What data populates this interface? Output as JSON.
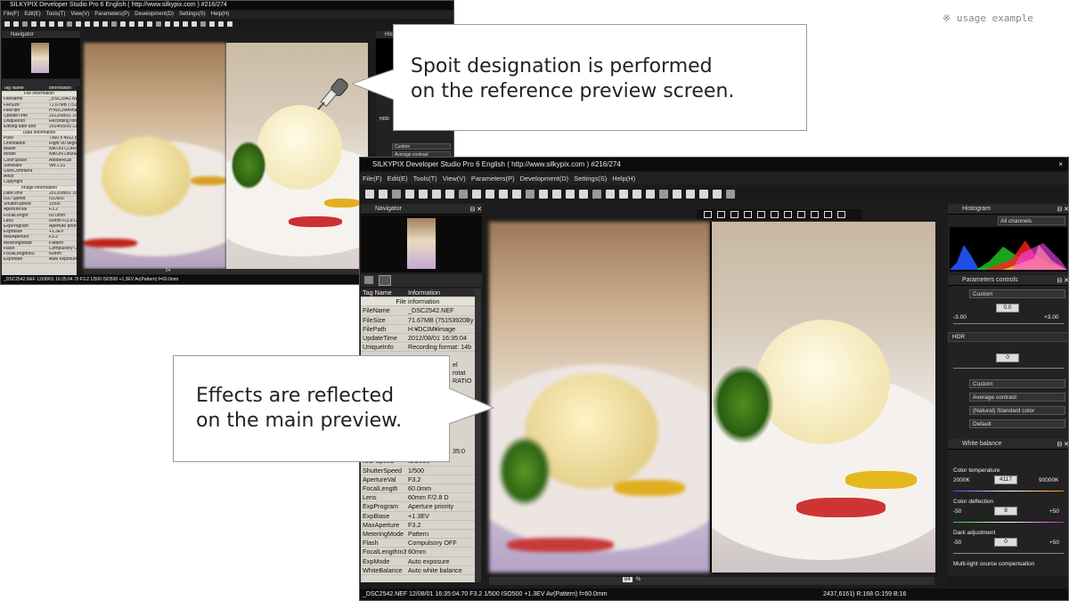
{
  "usage_note": "※ usage example",
  "back_window": {
    "title": "SILKYPIX Developer Studio Pro 6 English ( http://www.silkypix.com )  #216/274",
    "menu": [
      "File(F)",
      "Edit(E)",
      "Tools(T)",
      "View(V)",
      "Parameters(P)",
      "Development(D)",
      "Settings(S)",
      "Help(H)"
    ],
    "navigator_label": "Navigator",
    "histogram_label": "Histo",
    "tag_header": [
      "Tag Name",
      "Information"
    ],
    "file_section": "File information",
    "data_section": "Data information",
    "image_section": "Image information",
    "file_rows": [
      [
        "FileName",
        "_DSC2542.NEF"
      ],
      [
        "FileSize",
        "71.67MB (75153920By"
      ],
      [
        "FilePath",
        "H:¥DCIM¥image"
      ],
      [
        "UpdateTime",
        "2012/08/01 16:35:04"
      ],
      [
        "UniqueInfo",
        "Recording format: 14b"
      ],
      [
        "Editing date and",
        "2014/05/05 11:00:56"
      ]
    ],
    "data_rows": [
      [
        "Pixel",
        "7360 x 4912 pixel"
      ],
      [
        "Orientation",
        "Right 90 degree rotate"
      ],
      [
        "Maker",
        "NIKON CORPORATION"
      ],
      [
        "Model",
        "NIKON D800E"
      ],
      [
        "ColorSpace",
        "AdobeRGB"
      ],
      [
        "SoftWare",
        "Ver.1.01"
      ],
      [
        "UserComment",
        ""
      ],
      [
        "Artist",
        ""
      ],
      [
        "Copyright",
        ""
      ]
    ],
    "image_rows": [
      [
        "DateTime",
        "2012/08/01 16:35:0"
      ],
      [
        "ISO Speed",
        "ISO500"
      ],
      [
        "ShutterSpeed",
        "1/500"
      ],
      [
        "ApertureVal",
        "F3.2"
      ],
      [
        "FocalLength",
        "60.0mm"
      ],
      [
        "Lens",
        "60mm F/2.8 D"
      ],
      [
        "ExpProgram",
        "Aperture priority"
      ],
      [
        "ExpBiase",
        "+1.3EV"
      ],
      [
        "MaxAperture",
        "F3.2"
      ],
      [
        "MeteringMode",
        "Pattern"
      ],
      [
        "Flash",
        "Compulsory OFF"
      ],
      [
        "FocalLengthIn3",
        "60mm"
      ],
      [
        "ExpMode",
        "Auto exposure"
      ]
    ],
    "hdr_label": "HDR",
    "custom_label": "Custom",
    "avg_label": "Average contrast",
    "zoom": "84",
    "status": "_DSC2542.NEF 12/08/01 16:35:04.70 F3.2 1/500 ISO500 +1.3EV Av(Pattern) f=60.0mm"
  },
  "front_window": {
    "title": "SILKYPIX Developer Studio Pro 6 English ( http://www.silkypix.com )  #216/274",
    "menu": [
      "File(F)",
      "Edit(E)",
      "Tools(T)",
      "View(V)",
      "Parameters(P)",
      "Development(D)",
      "Settings(S)",
      "Help(H)"
    ],
    "navigator_label": "Navigator",
    "histogram_label": "Histogram",
    "channel": "All channels",
    "tag_header": [
      "Tag Name",
      "Information"
    ],
    "file_section": "File information",
    "file_rows": [
      [
        "FileName",
        "_DSC2542.NEF"
      ],
      [
        "FileSize",
        "71.67MB (75153920By"
      ],
      [
        "FilePath",
        "H:¥DCIM¥image"
      ],
      [
        "UpdateTime",
        "2012/08/01 16:35:04"
      ],
      [
        "UniqueInfo",
        "Recording format: 14b"
      ]
    ],
    "partial_rows": [
      "el",
      "rotat",
      "RATIO"
    ],
    "partial_date": "35:0",
    "image_rows": [
      [
        "ISO Speed",
        "ISO500"
      ],
      [
        "ShutterSpeed",
        "1/500"
      ],
      [
        "ApertureVal",
        "F3.2"
      ],
      [
        "FocalLength",
        "60.0mm"
      ],
      [
        "Lens",
        "60mm F/2.8 D"
      ],
      [
        "ExpProgram",
        "Aperture priority"
      ],
      [
        "ExpBiase",
        "+1.3EV"
      ],
      [
        "MaxAperture",
        "F3.2"
      ],
      [
        "MeteringMode",
        "Pattern"
      ],
      [
        "Flash",
        "Compulsory OFF"
      ],
      [
        "FocalLengthIn3",
        "60mm"
      ],
      [
        "ExpMode",
        "Auto exposure"
      ],
      [
        "WhiteBalance",
        "Auto white balance"
      ]
    ],
    "params": {
      "title": "Parameters controls",
      "preset": "Custom",
      "exposure_value": "0.0",
      "exposure_min": "-3.00",
      "exposure_max": "+3.00",
      "hdr_label": "HDR",
      "hdr_value": "0",
      "tone_preset": "Custom",
      "contrast": "Average contrast",
      "color": "(Natural) Standard color",
      "sharpness": "Default"
    },
    "wb": {
      "title": "White balance",
      "temp_label": "Color temperature",
      "temp_min": "2000K",
      "temp_value": "4117",
      "temp_max": "90000K",
      "defl_label": "Color deflection",
      "defl_min": "-50",
      "defl_value": "8",
      "defl_max": "+50",
      "dark_label": "Dark adjustment",
      "dark_min": "-50",
      "dark_value": "0",
      "dark_max": "+50",
      "multi_label": "Multi-light source compensation"
    },
    "zoom": "84",
    "zoom_unit": "%",
    "status": "_DSC2542.NEF 12/08/01 16:35:04.70 F3.2 1/500 ISO500 +1.3EV Av(Pattern) f=60.0mm",
    "coords": "2437,6161) R:168 G:159 B:16"
  },
  "callout_top": {
    "line1": "Spoit designation is performed",
    "line2": "on the reference preview screen."
  },
  "callout_bottom": {
    "line1": "Effects are reflected",
    "line2": "on the main preview."
  },
  "colors": {
    "accent": "#3399ff",
    "window_bg": "#1c1c1c",
    "tag_bg": "#d8d4cc"
  }
}
